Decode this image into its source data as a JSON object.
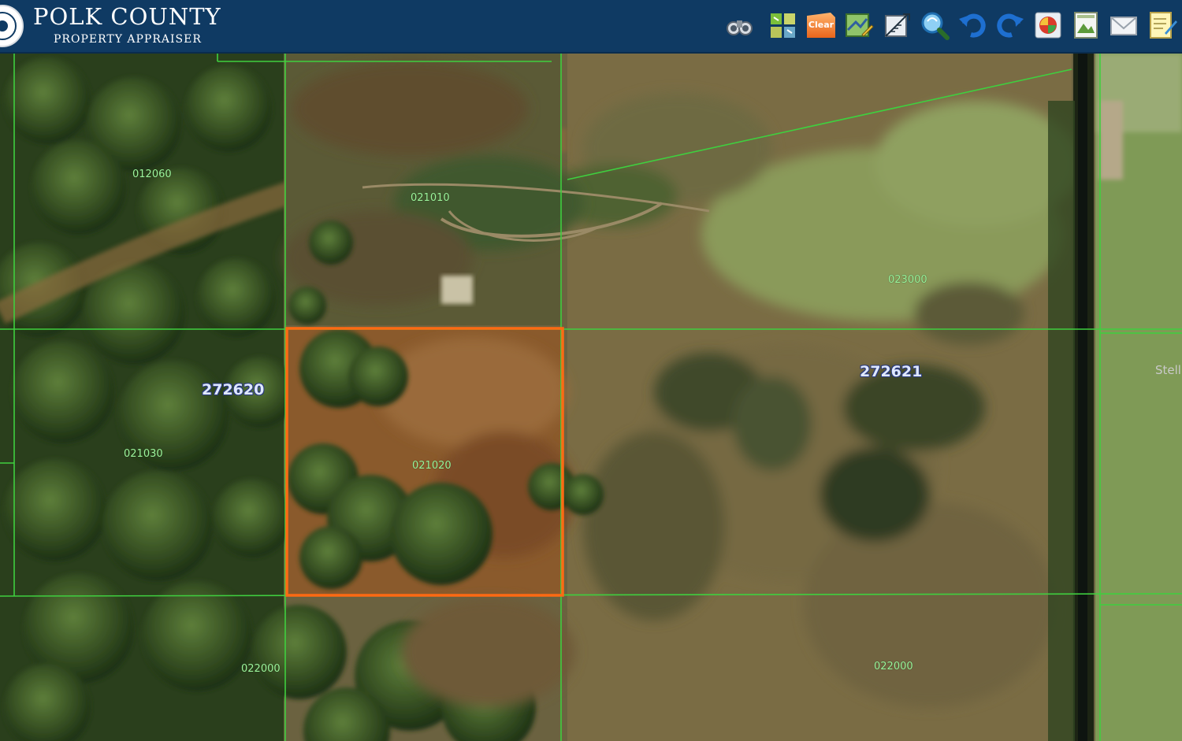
{
  "header": {
    "title": "POLK COUNTY",
    "subtitle": "PROPERTY APPRAISER",
    "seal_text": "PROPERTY APPRAISER"
  },
  "toolbar": {
    "clear_label": "Clear",
    "tools": [
      "binoculars-icon",
      "grid-icon",
      "clear-icon",
      "map-edit-icon",
      "measure-icon",
      "zoom-icon",
      "undo-icon",
      "redo-icon",
      "palette-icon",
      "image-icon",
      "mail-icon",
      "notepad-icon"
    ]
  },
  "map": {
    "section_labels": {
      "west": "272620",
      "east": "272621"
    },
    "parcel_labels": {
      "nw": "012060",
      "north": "021010",
      "ne": "023000",
      "west": "021030",
      "selected": "021020",
      "south": "022000",
      "se": "022000"
    },
    "edge_label": "Stell",
    "colors": {
      "parcel_line": "#3fcf3f",
      "selection": "#ff6a13",
      "header": "#0f3a63"
    }
  }
}
